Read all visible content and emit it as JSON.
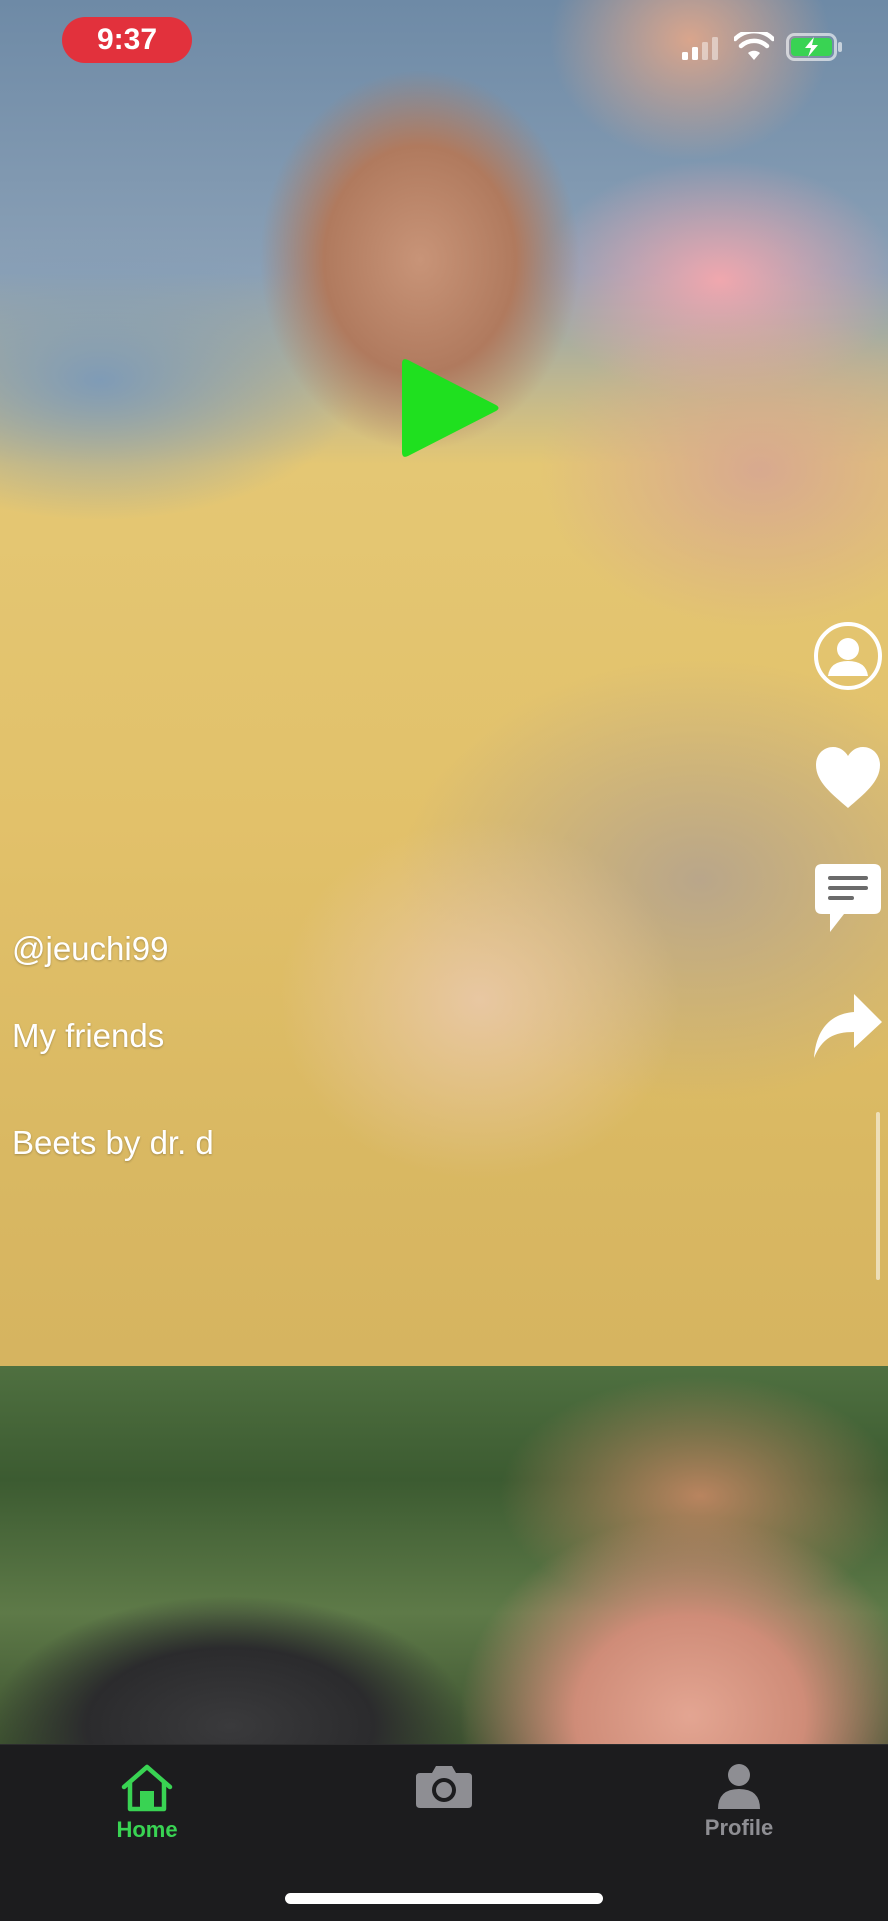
{
  "status_bar": {
    "time": "9:37",
    "time_pill_color": "#e2313c",
    "battery_color": "#39d353"
  },
  "player": {
    "play_icon": "play-icon",
    "play_icon_color": "#1fe01f"
  },
  "post": {
    "username": "@jeuchi99",
    "caption": "My friends",
    "sound": "Beets by dr. d"
  },
  "actions": [
    {
      "name": "profile",
      "icon": "user-circle-icon"
    },
    {
      "name": "like",
      "icon": "heart-icon"
    },
    {
      "name": "comment",
      "icon": "comment-icon"
    },
    {
      "name": "share",
      "icon": "share-arrow-icon"
    }
  ],
  "tab_bar": {
    "active_color": "#39d353",
    "inactive_color": "#8e8e93",
    "tabs": [
      {
        "label": "Home",
        "icon": "home-icon",
        "active": true
      },
      {
        "label": "",
        "icon": "camera-icon",
        "active": false
      },
      {
        "label": "Profile",
        "icon": "person-icon",
        "active": false
      }
    ]
  }
}
